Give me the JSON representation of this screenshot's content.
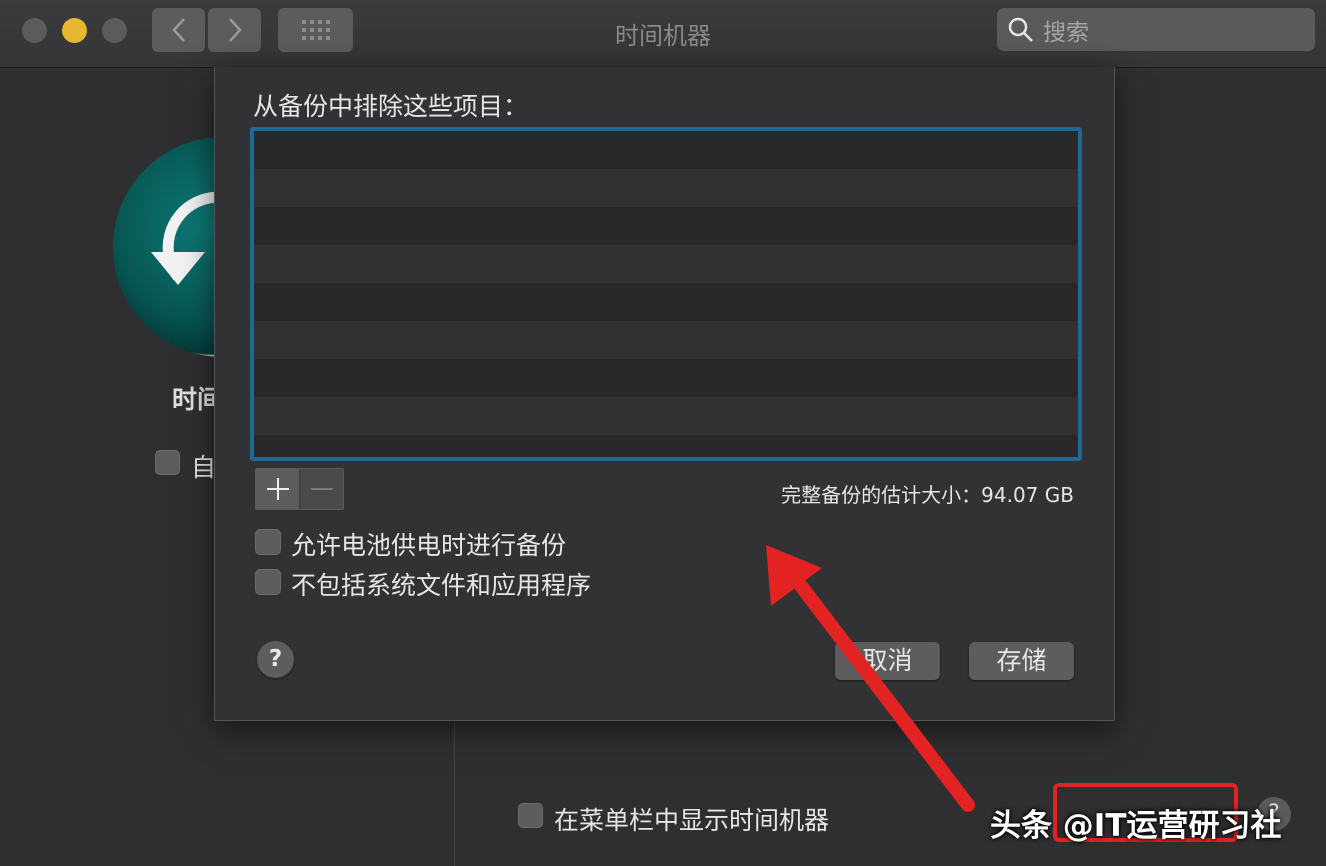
{
  "window": {
    "title": "时间机器",
    "search_placeholder": "搜索",
    "traffic_light_colors": [
      "#5b5b5d",
      "#e6b830",
      "#5b5b5d"
    ]
  },
  "background_pane": {
    "title_partial": "时间",
    "auto_backup_partial": "自",
    "show_in_menubar_label": "在菜单栏中显示时间机器",
    "help_label": "?"
  },
  "sheet": {
    "heading": "从备份中排除这些项目：",
    "excluded_items": [],
    "add_button": "+",
    "remove_button": "—",
    "estimated_size_label": "完整备份的估计大小：94.07 GB",
    "options": [
      {
        "label": "允许电池供电时进行备份",
        "checked": false
      },
      {
        "label": "不包括系统文件和应用程序",
        "checked": false
      }
    ],
    "help_label": "?",
    "cancel_label": "取消",
    "save_label": "存储"
  },
  "annotation": {
    "arrow_color": "#e32222",
    "highlight_color": "#e32222",
    "watermark": "头条 @IT运营研习社"
  }
}
